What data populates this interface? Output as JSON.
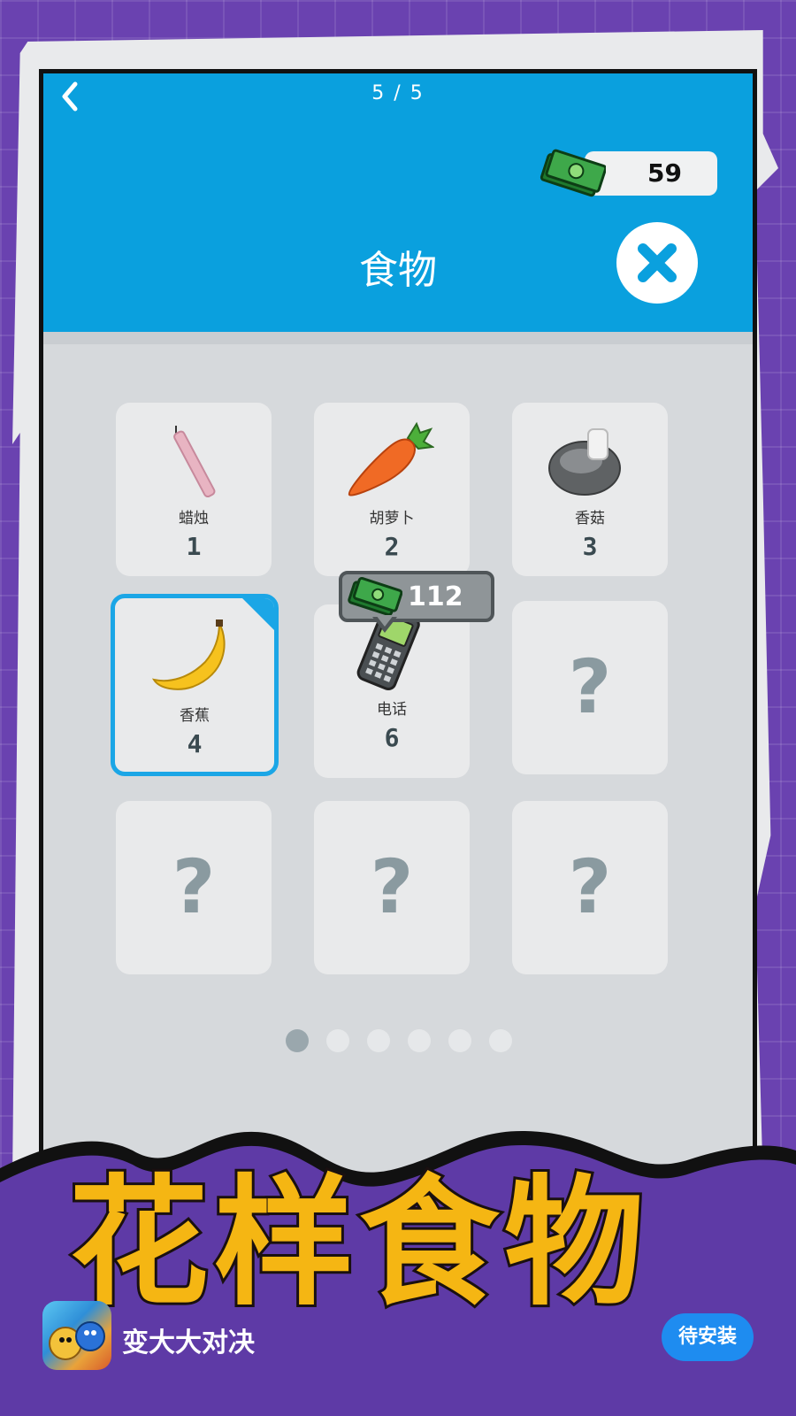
{
  "header": {
    "page_indicator": "5 / 5",
    "money": "59",
    "title": "食物"
  },
  "items": [
    {
      "label": "蜡烛",
      "number": "1",
      "icon": "candle-icon"
    },
    {
      "label": "胡萝卜",
      "number": "2",
      "icon": "carrot-icon"
    },
    {
      "label": "香菇",
      "number": "3",
      "icon": "mushroom-icon"
    },
    {
      "label": "香蕉",
      "number": "4",
      "icon": "banana-icon",
      "selected": true
    },
    {
      "label": "电话",
      "number": "6",
      "icon": "phone-icon"
    },
    {
      "label": "",
      "number": "",
      "icon": "unknown-icon",
      "locked_glyph": "?"
    },
    {
      "label": "",
      "number": "",
      "icon": "unknown-icon",
      "locked_glyph": "?"
    },
    {
      "label": "",
      "number": "",
      "icon": "unknown-icon",
      "locked_glyph": "?"
    },
    {
      "label": "",
      "number": "",
      "icon": "unknown-icon",
      "locked_glyph": "?"
    }
  ],
  "price_tooltip": {
    "value": "112"
  },
  "pagination": {
    "total": 6,
    "active_index": 0
  },
  "banner": {
    "text": "花样食物"
  },
  "ad": {
    "app_name": "变大大对决",
    "install_label": "待安装"
  },
  "colors": {
    "header_blue": "#0aa0de",
    "selected_border": "#1ba6e6",
    "banner_yellow": "#f5b613",
    "install_blue": "#1e8cf0",
    "background_purple": "#6a42b0"
  }
}
